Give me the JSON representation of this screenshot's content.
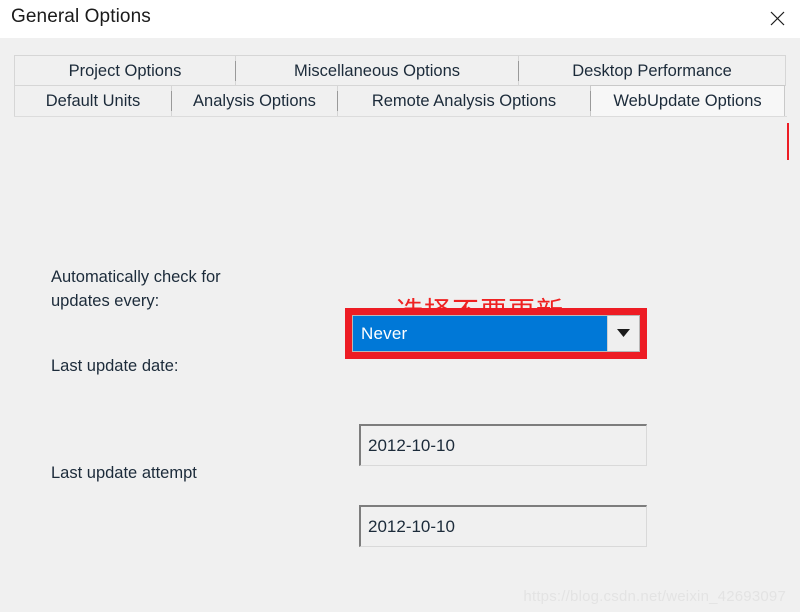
{
  "window": {
    "title": "General Options",
    "close_icon": "close-icon"
  },
  "tabs": {
    "row_top": [
      {
        "label": "Project Options",
        "active": false
      },
      {
        "label": "Miscellaneous Options",
        "active": false
      },
      {
        "label": "Desktop Performance",
        "active": false
      }
    ],
    "row_bottom": [
      {
        "label": "Default Units",
        "active": false
      },
      {
        "label": "Analysis Options",
        "active": false
      },
      {
        "label": "Remote Analysis Options",
        "active": false
      },
      {
        "label": "WebUpdate Options",
        "active": true
      }
    ]
  },
  "form": {
    "auto_check_label": "Automatically check for\nupdates every:",
    "auto_check_value": "Never",
    "auto_check_arrow_icon": "chevron-down-icon",
    "last_update_date_label": "Last update date:",
    "last_update_date_value": "2012-10-10",
    "last_update_attempt_label": "Last update attempt",
    "last_update_attempt_label_clipped": ":",
    "last_update_attempt_value": "2012-10-10"
  },
  "annotations": {
    "chinese_note": "选择不要更新",
    "highlight_color": "#ed1c24"
  },
  "watermark": {
    "text": "https://blog.csdn.net/weixin_42693097"
  },
  "colors": {
    "accent_blue": "#0078d7",
    "annotation_red": "#ed1c24",
    "panel_gray": "#f0f0f0",
    "text": "#1c2b3a"
  }
}
